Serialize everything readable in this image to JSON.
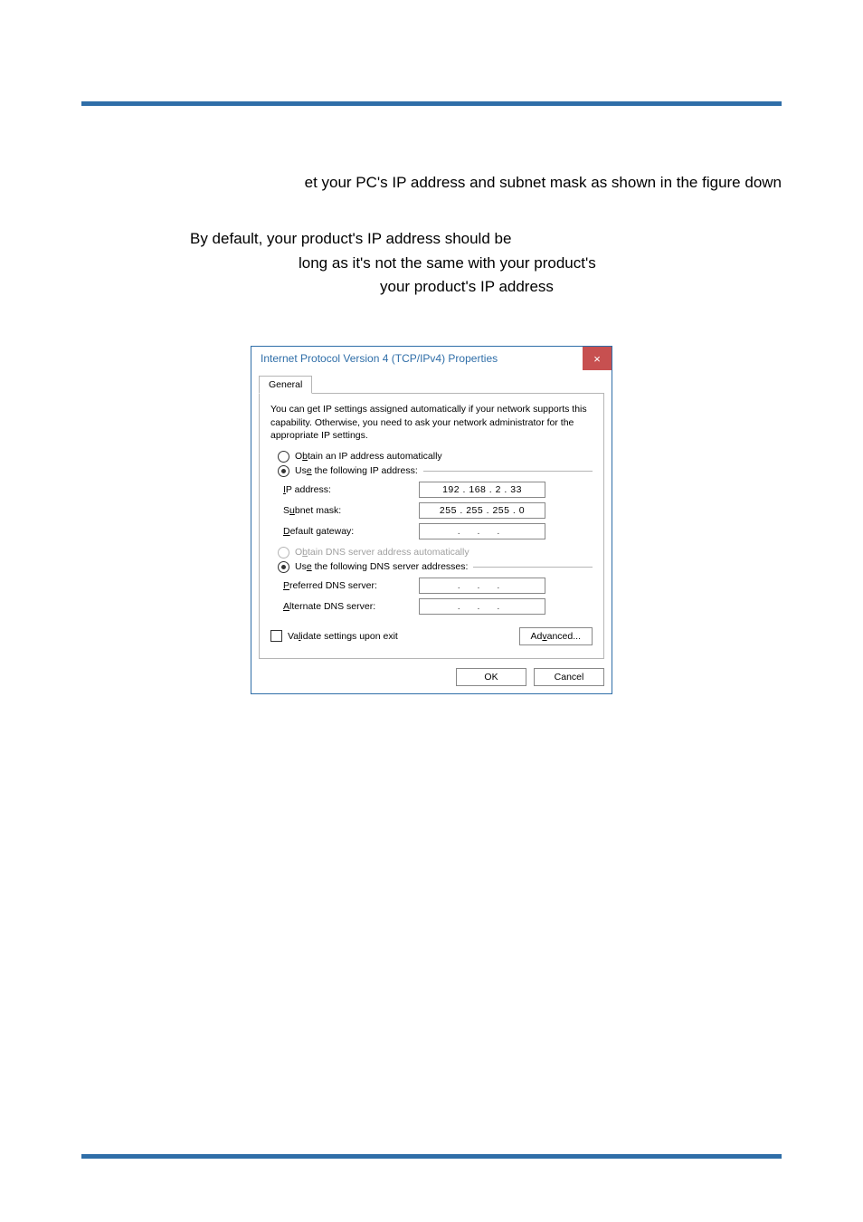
{
  "body": {
    "line1": "et your PC's IP address and subnet mask as shown in the figure down",
    "line2": "By default, your product's IP address should be",
    "line3": "long as it's not the same with your product's",
    "line4": "your product's IP address"
  },
  "dialog": {
    "title": "Internet Protocol Version 4 (TCP/IPv4) Properties",
    "close": "×",
    "tab": "General",
    "description": "You can get IP settings assigned automatically if your network supports this capability. Otherwise, you need to ask your network administrator for the appropriate IP settings.",
    "radio_ip_auto_pre": "O",
    "radio_ip_auto_u": "b",
    "radio_ip_auto_post": "tain an IP address automatically",
    "radio_ip_manual_pre": "Us",
    "radio_ip_manual_u": "e",
    "radio_ip_manual_post": " the following IP address:",
    "ip_label_u": "I",
    "ip_label_post": "P address:",
    "ip_value": "192 . 168 .  2  . 33",
    "subnet_label_pre": "S",
    "subnet_label_u": "u",
    "subnet_label_post": "bnet mask:",
    "subnet_value": "255 . 255 . 255 .  0",
    "gateway_label_u": "D",
    "gateway_label_post": "efault gateway:",
    "gateway_value": ".     .     .",
    "radio_dns_auto_pre": "O",
    "radio_dns_auto_u": "b",
    "radio_dns_auto_post": "tain DNS server address automatically",
    "radio_dns_manual_pre": "Us",
    "radio_dns_manual_u": "e",
    "radio_dns_manual_post": " the following DNS server addresses:",
    "pdns_label_u": "P",
    "pdns_label_post": "referred DNS server:",
    "pdns_value": ".     .     .",
    "adns_label_u": "A",
    "adns_label_post": "lternate DNS server:",
    "adns_value": ".     .     .",
    "validate_pre": "Va",
    "validate_u": "l",
    "validate_post": "idate settings upon exit",
    "advanced_pre": "Ad",
    "advanced_u": "v",
    "advanced_post": "anced...",
    "ok": "OK",
    "cancel": "Cancel"
  }
}
